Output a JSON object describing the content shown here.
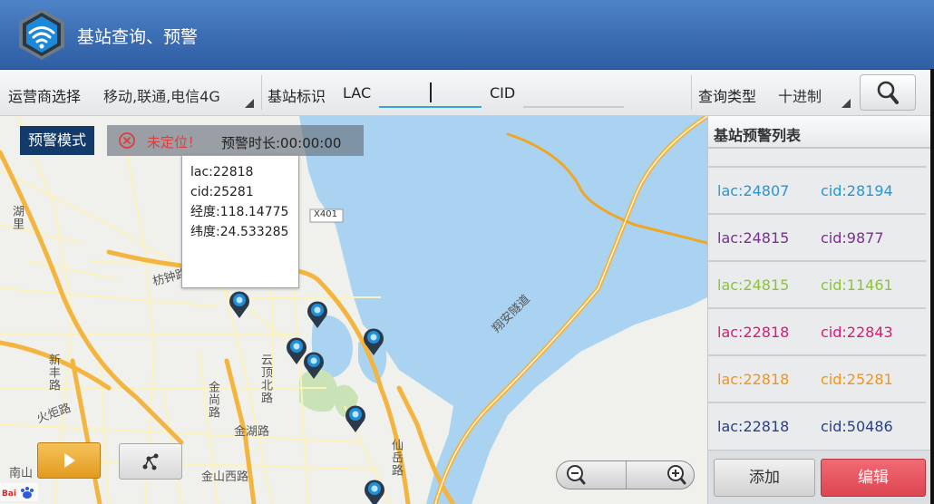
{
  "app": {
    "title": "基站查询、预警",
    "logo_icon": "wifi-hexagon-icon"
  },
  "toolbar": {
    "operator_label": "运营商选择",
    "operator_value": "移动,联通,电信4G",
    "station_label": "基站标识",
    "lac_label": "LAC",
    "lac_value": "",
    "cid_label": "CID",
    "cid_value": "",
    "query_type_label": "查询类型",
    "query_type_value": "十进制",
    "search_icon": "search-icon"
  },
  "map": {
    "mode_badge": "预警模式",
    "status_icon": "close-circle-icon",
    "status_text": "未定位！",
    "duration_text": "预警时长:00:00:00",
    "popup": {
      "lac": "lac:22818",
      "cid": "cid:25281",
      "lng": "经度:118.14775",
      "lat": "纬度:24.533285"
    },
    "labels": {
      "highway": "X401",
      "road_1": "云顶北路",
      "road_2": "金尚路",
      "road_3": "金湖路",
      "road_4": "仙岳路",
      "road_5": "翔安隧道",
      "road_6": "新丰路",
      "road_7": "火炬路",
      "road_8": "枋钟路",
      "road_9": "金山西路",
      "road_10": "南山",
      "road_11": "湖里",
      "road_12": "",
      "road_13": "",
      "road_14": "",
      "road_15": ""
    },
    "play_icon": "play-icon",
    "route_icon": "route-icon",
    "zoom_out_icon": "zoom-out-icon",
    "zoom_in_icon": "zoom-in-icon",
    "watermark": "Baidu地图"
  },
  "panel": {
    "title": "基站预警列表",
    "items": [
      {
        "lac": "lac:24807",
        "cid": "cid:28194",
        "color": "#2a95d3"
      },
      {
        "lac": "lac:24815",
        "cid": "cid:9877",
        "color": "#7a2f8e"
      },
      {
        "lac": "lac:24815",
        "cid": "cid:11461",
        "color": "#8ec23b"
      },
      {
        "lac": "lac:22818",
        "cid": "cid:22843",
        "color": "#d81b77"
      },
      {
        "lac": "lac:22818",
        "cid": "cid:25281",
        "color": "#f29418"
      },
      {
        "lac": "lac:22818",
        "cid": "cid:50486",
        "color": "#283f86"
      }
    ],
    "add_label": "添加",
    "edit_label": "编辑"
  }
}
